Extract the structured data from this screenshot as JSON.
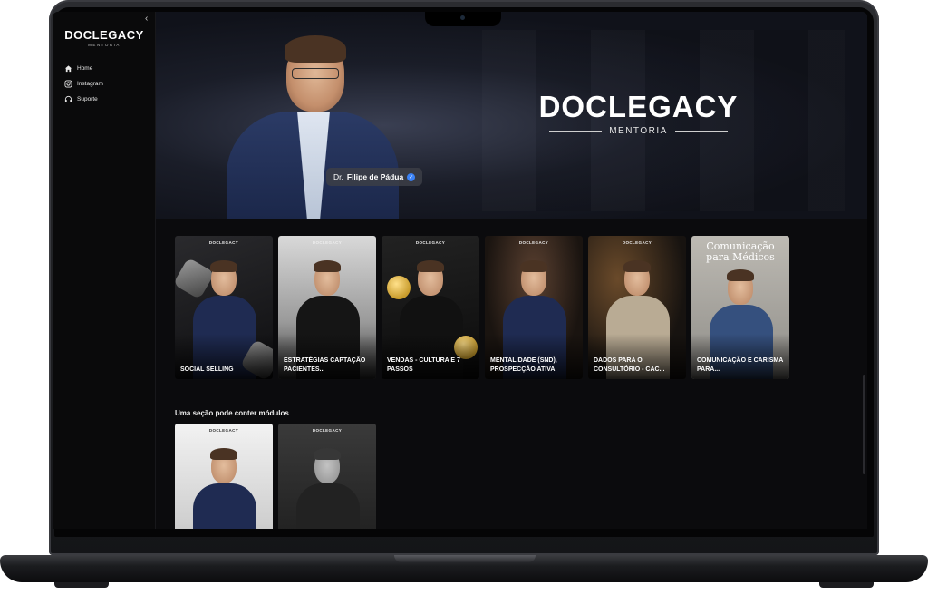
{
  "app": {
    "logo_word": "DOCLEGACY",
    "logo_sub": "MENTORIA",
    "collapse_icon": "‹"
  },
  "sidebar": {
    "items": [
      {
        "label": "Home",
        "icon": "home-icon"
      },
      {
        "label": "Instagram",
        "icon": "instagram-icon"
      },
      {
        "label": "Suporte",
        "icon": "headset-icon"
      }
    ]
  },
  "hero": {
    "brand_word": "DOCLEGACY",
    "brand_sub": "MENTORIA",
    "name_prefix": "Dr.",
    "name": "Filipe de Pádua"
  },
  "modules": [
    {
      "brand": "DOCLEGACY",
      "title": "SOCIAL SELLING"
    },
    {
      "brand": "DOCLEGACY",
      "title": "ESTRATÉGIAS CAPTAÇÃO PACIENTES..."
    },
    {
      "brand": "DOCLEGACY",
      "title": "VENDAS - CULTURA E 7 PASSOS"
    },
    {
      "brand": "DOCLEGACY",
      "title": "MENTALIDADE (SND), PROSPECÇÃO ATIVA"
    },
    {
      "brand": "DOCLEGACY",
      "title": "DADOS PARA O CONSULTÓRIO - CAC..."
    },
    {
      "brand": "DOCLEGACY",
      "title": "COMUNICAÇÃO E CARISMA PARA...",
      "cover_text": "Comunicação para Médicos"
    }
  ],
  "section2": {
    "title": "Uma seção pode conter módulos",
    "modules": [
      {
        "brand": "DOCLEGACY"
      },
      {
        "brand": "DOCLEGACY"
      }
    ]
  },
  "colors": {
    "background": "#0b0b0d",
    "accent": "#3b82f6"
  }
}
